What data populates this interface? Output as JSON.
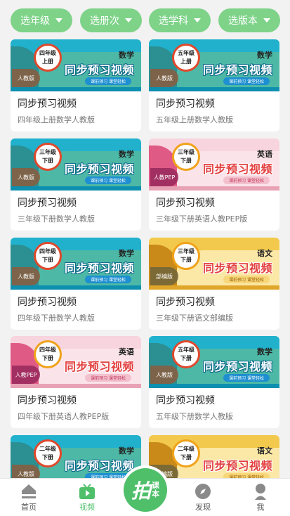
{
  "filters": [
    {
      "label": "选年级"
    },
    {
      "label": "选册次"
    },
    {
      "label": "选学科"
    },
    {
      "label": "选版本"
    }
  ],
  "cards": [
    {
      "theme": "teal",
      "grade_line1": "四年级",
      "grade_line2": "上册",
      "edition": "人教版",
      "subject": "数学",
      "series": "同步预习视频",
      "slogan": "课前预习 课堂轻松",
      "title": "同步预习视频",
      "subtitle": "四年级上册数学人教版"
    },
    {
      "theme": "teal",
      "grade_line1": "五年级",
      "grade_line2": "上册",
      "edition": "人教版",
      "subject": "数学",
      "series": "同步预习视频",
      "slogan": "课前预习 课堂轻松",
      "title": "同步预习视频",
      "subtitle": "五年级上册数学人教版"
    },
    {
      "theme": "teal",
      "grade_line1": "三年级",
      "grade_line2": "下册",
      "edition": "人教版",
      "subject": "数学",
      "series": "同步预习视频",
      "slogan": "课前预习 课堂轻松",
      "title": "同步预习视频",
      "subtitle": "三年级下册数学人教版"
    },
    {
      "theme": "pink",
      "grade_line1": "三年级",
      "grade_line2": "下册",
      "edition": "人教PEP",
      "subject": "英语",
      "series": "同步预习视频",
      "slogan": "课前预习 课堂轻松",
      "title": "同步预习视频",
      "subtitle": "三年级下册英语人教PEP版"
    },
    {
      "theme": "teal",
      "grade_line1": "四年级",
      "grade_line2": "下册",
      "edition": "人教版",
      "subject": "数学",
      "series": "同步预习视频",
      "slogan": "课前预习 课堂轻松",
      "title": "同步预习视频",
      "subtitle": "四年级下册数学人教版"
    },
    {
      "theme": "yellow",
      "grade_line1": "三年级",
      "grade_line2": "下册",
      "edition": "部编版",
      "subject": "语文",
      "series": "同步预习视频",
      "slogan": "课前预习 课堂轻松",
      "title": "同步预习视频",
      "subtitle": "三年级下册语文部编版"
    },
    {
      "theme": "pink",
      "grade_line1": "四年级",
      "grade_line2": "下册",
      "edition": "人教PEP",
      "subject": "英语",
      "series": "同步预习视频",
      "slogan": "课前预习 课堂轻松",
      "title": "同步预习视频",
      "subtitle": "四年级下册英语人教PEP版"
    },
    {
      "theme": "teal",
      "grade_line1": "五年级",
      "grade_line2": "下册",
      "edition": "人教版",
      "subject": "数学",
      "series": "同步预习视频",
      "slogan": "课前预习 课堂轻松",
      "title": "同步预习视频",
      "subtitle": "五年级下册数学人教版"
    },
    {
      "theme": "teal",
      "grade_line1": "二年级",
      "grade_line2": "下册",
      "edition": "人教版",
      "subject": "数学",
      "series": "同步预习视频",
      "slogan": "课前预习 课堂轻松",
      "title": "",
      "subtitle": ""
    },
    {
      "theme": "yellow",
      "grade_line1": "二年级",
      "grade_line2": "下册",
      "edition": "部编版",
      "subject": "语文",
      "series": "同步预习视频",
      "slogan": "课前预习 课堂轻松",
      "title": "",
      "subtitle": ""
    }
  ],
  "nav": {
    "home": "首页",
    "video": "视频",
    "center_big": "拍",
    "center_small1": "课",
    "center_small2": "本",
    "discover": "发现",
    "me": "我"
  },
  "colors": {
    "accent": "#4fbf6a",
    "filter_bg": "#7ed389"
  },
  "icons": {
    "home": "home-icon",
    "video": "tv-play-icon",
    "discover": "compass-icon",
    "me": "user-icon"
  }
}
